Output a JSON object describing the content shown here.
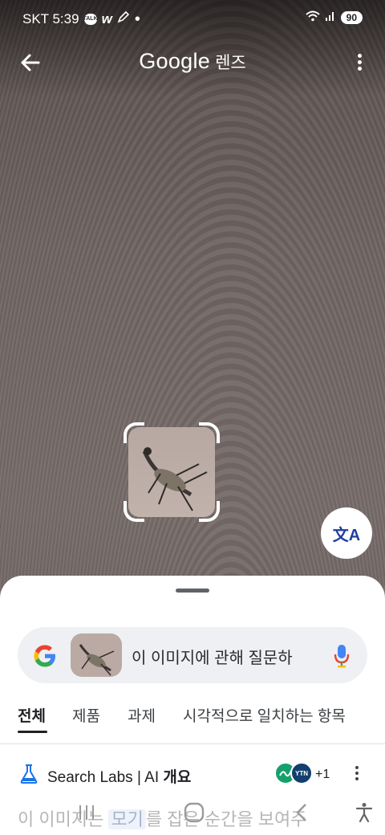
{
  "status_bar": {
    "carrier_time": "SKT 5:39",
    "talk_icon_label": "TALK",
    "battery": "90",
    "icons": [
      "kakaotalk-icon",
      "w-app-icon",
      "pen-icon",
      "dot-icon",
      "wifi-icon",
      "signal-icon"
    ]
  },
  "app_bar": {
    "title_google": "Google",
    "title_lens": "렌즈",
    "back_icon": "arrow-left-icon",
    "menu_icon": "more-vert-icon"
  },
  "translate_button": {
    "icon": "translate-icon",
    "glyph": "文A"
  },
  "sheet": {
    "search_placeholder": "이 이미지에 관해 질문하",
    "tabs": [
      "전체",
      "제품",
      "과제",
      "시각적으로 일치하는 항목"
    ],
    "active_tab": "전체",
    "labs": {
      "brand": "Search Labs",
      "separator": " | ",
      "ai": "AI",
      "overview": "개요",
      "more_count": "+1",
      "avatar2_text": "YTN"
    },
    "answer": {
      "part1": "이 이미지는 ",
      "highlight": "모기",
      "part2": "를 잡은 순간을 보여주"
    }
  },
  "colors": {
    "accent_blue": "#1a73e8",
    "sheet_bg": "#ffffff",
    "search_bg": "#eef0f3"
  },
  "nav_bar": {
    "icons": [
      "recent-apps-icon",
      "home-icon",
      "back-icon",
      "accessibility-icon"
    ]
  }
}
